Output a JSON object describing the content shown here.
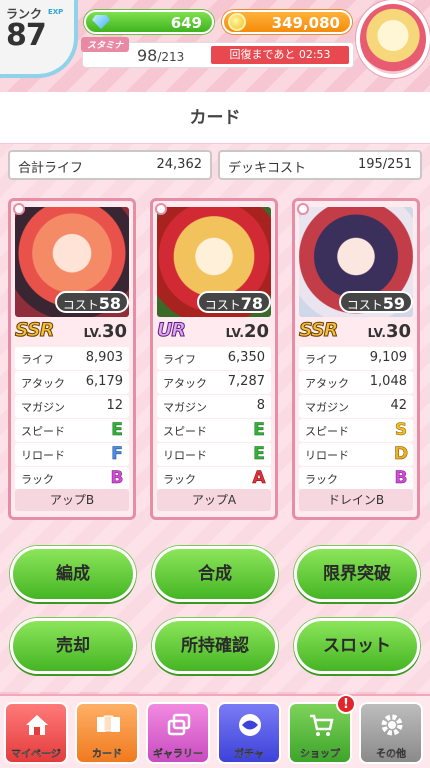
{
  "hud": {
    "rank_label": "ランク",
    "exp_label": "EXP",
    "rank_value": "87",
    "gems": "649",
    "coins": "349,080",
    "stamina_label": "スタミナ",
    "stamina_current": "98",
    "stamina_max": "/213",
    "recover_text": "回復まであと 02:53"
  },
  "page": {
    "title": "カード"
  },
  "totals": {
    "life_label": "合計ライフ",
    "life_value": "24,362",
    "deck_cost_label": "デッキコスト",
    "deck_cost_value": "195/251"
  },
  "cards": [
    {
      "cost_label": "コスト",
      "cost": "58",
      "rarity": "SSR",
      "lv_label": "LV.",
      "lv": "30",
      "stats": [
        {
          "k": "ライフ",
          "v": "8,903"
        },
        {
          "k": "アタック",
          "v": "6,179"
        },
        {
          "k": "マガジン",
          "v": "12"
        },
        {
          "k": "スピード",
          "v": "E"
        },
        {
          "k": "リロード",
          "v": "F"
        },
        {
          "k": "ラック",
          "v": "B"
        }
      ],
      "skill": "アップB"
    },
    {
      "cost_label": "コスト",
      "cost": "78",
      "rarity": "UR",
      "lv_label": "LV.",
      "lv": "20",
      "stats": [
        {
          "k": "ライフ",
          "v": "6,350"
        },
        {
          "k": "アタック",
          "v": "7,287"
        },
        {
          "k": "マガジン",
          "v": "8"
        },
        {
          "k": "スピード",
          "v": "E"
        },
        {
          "k": "リロード",
          "v": "E"
        },
        {
          "k": "ラック",
          "v": "A"
        }
      ],
      "skill": "アップA"
    },
    {
      "cost_label": "コスト",
      "cost": "59",
      "rarity": "SSR",
      "lv_label": "LV.",
      "lv": "30",
      "stats": [
        {
          "k": "ライフ",
          "v": "9,109"
        },
        {
          "k": "アタック",
          "v": "1,048"
        },
        {
          "k": "マガジン",
          "v": "42"
        },
        {
          "k": "スピード",
          "v": "S"
        },
        {
          "k": "リロード",
          "v": "D"
        },
        {
          "k": "ラック",
          "v": "B"
        }
      ],
      "skill": "ドレインB"
    }
  ],
  "actions": {
    "organize": "編成",
    "fuse": "合成",
    "limit_break": "限界突破",
    "sell": "売却",
    "owned_check": "所持確認",
    "slot": "スロット"
  },
  "nav": {
    "home": "マイページ",
    "card": "カード",
    "gallery": "ギャラリー",
    "gacha": "ガチャ",
    "shop": "ショップ",
    "shop_badge": "!",
    "other": "その他"
  }
}
